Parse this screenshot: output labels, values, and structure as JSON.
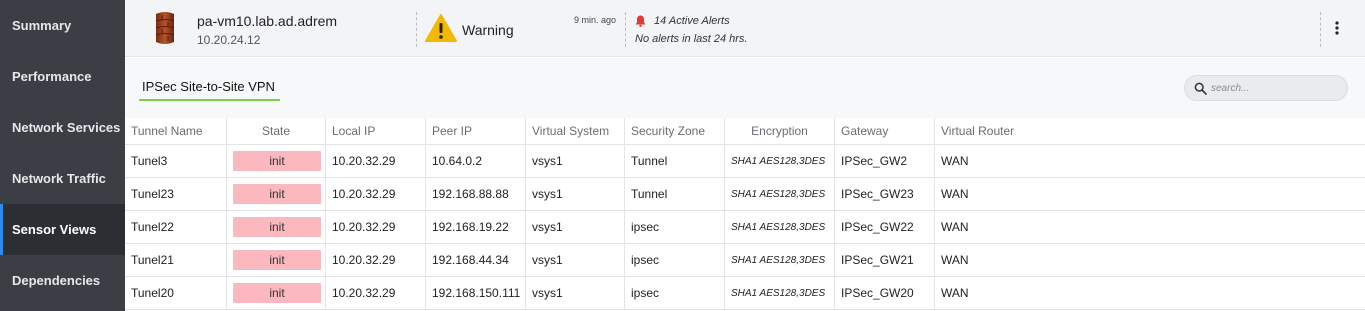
{
  "sidebar": {
    "items": [
      {
        "label": "Summary"
      },
      {
        "label": "Performance"
      },
      {
        "label": "Network Services"
      },
      {
        "label": "Network Traffic"
      },
      {
        "label": "Sensor Views",
        "active": true
      },
      {
        "label": "Dependencies"
      }
    ]
  },
  "header": {
    "device_name": "pa-vm10.lab.ad.adrem",
    "device_ip": "10.20.24.12",
    "device_icon": "firewall-icon",
    "status_label": "Warning",
    "status_time": "9 min. ago",
    "alerts_count_label": "14 Active Alerts",
    "alerts_sub_label": "No alerts in last 24 hrs.",
    "warning_color": "#f5b800",
    "bell_color": "#e03b3b"
  },
  "tabs": [
    {
      "label": "IPSec Site-to-Site VPN",
      "active": true
    }
  ],
  "search": {
    "placeholder": "search..."
  },
  "table": {
    "columns": [
      "Tunnel Name",
      "State",
      "Local IP",
      "Peer IP",
      "Virtual System",
      "Security Zone",
      "Encryption",
      "Gateway",
      "Virtual Router"
    ],
    "rows": [
      {
        "tunnel": "Tunel3",
        "state": "init",
        "local_ip": "10.20.32.29",
        "peer_ip": "10.64.0.2",
        "vsys": "vsys1",
        "zone": "Tunnel",
        "encryption": "SHA1 AES128,3DES",
        "gateway": "IPSec_GW2",
        "router": "WAN"
      },
      {
        "tunnel": "Tunel23",
        "state": "init",
        "local_ip": "10.20.32.29",
        "peer_ip": "192.168.88.88",
        "vsys": "vsys1",
        "zone": "Tunnel",
        "encryption": "SHA1 AES128,3DES",
        "gateway": "IPSec_GW23",
        "router": "WAN"
      },
      {
        "tunnel": "Tunel22",
        "state": "init",
        "local_ip": "10.20.32.29",
        "peer_ip": "192.168.19.22",
        "vsys": "vsys1",
        "zone": "ipsec",
        "encryption": "SHA1 AES128,3DES",
        "gateway": "IPSec_GW22",
        "router": "WAN"
      },
      {
        "tunnel": "Tunel21",
        "state": "init",
        "local_ip": "10.20.32.29",
        "peer_ip": "192.168.44.34",
        "vsys": "vsys1",
        "zone": "ipsec",
        "encryption": "SHA1 AES128,3DES",
        "gateway": "IPSec_GW21",
        "router": "WAN"
      },
      {
        "tunnel": "Tunel20",
        "state": "init",
        "local_ip": "10.20.32.29",
        "peer_ip": "192.168.150.111",
        "vsys": "vsys1",
        "zone": "ipsec",
        "encryption": "SHA1 AES128,3DES",
        "gateway": "IPSec_GW20",
        "router": "WAN"
      }
    ],
    "state_badge_color": "#fbb8bf"
  },
  "colors": {
    "sidebar_bg": "#3b3e44",
    "sidebar_active_bg": "#2b2e33",
    "sidebar_active_accent": "#2d8ceb",
    "tab_underline": "#7ccf47"
  }
}
